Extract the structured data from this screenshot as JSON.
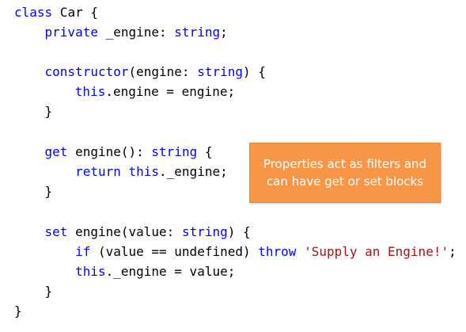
{
  "code": {
    "lines": [
      {
        "key": "l1",
        "tokens": [
          {
            "t": "class",
            "k": "kw"
          },
          {
            "t": " Car {",
            "k": "pl"
          }
        ]
      },
      {
        "key": "l2",
        "tokens": [
          {
            "t": "    ",
            "k": "pl"
          },
          {
            "t": "private",
            "k": "kw"
          },
          {
            "t": " _engine: ",
            "k": "pl"
          },
          {
            "t": "string",
            "k": "kw"
          },
          {
            "t": ";",
            "k": "pl"
          }
        ]
      },
      {
        "key": "l3",
        "tokens": [
          {
            "t": "    ",
            "k": "pl"
          },
          {
            "t": "constructor",
            "k": "kw"
          },
          {
            "t": "(engine: ",
            "k": "pl"
          },
          {
            "t": "string",
            "k": "kw"
          },
          {
            "t": ") {",
            "k": "pl"
          }
        ]
      },
      {
        "key": "l4",
        "tokens": [
          {
            "t": "      ",
            "k": "pl"
          },
          {
            "t": "this",
            "k": "kw"
          },
          {
            "t": ".engine = engine;",
            "k": "pl"
          }
        ]
      },
      {
        "key": "l5",
        "tokens": [
          {
            "t": "    }",
            "k": "pl"
          }
        ]
      },
      {
        "key": "l6",
        "tokens": [
          {
            "t": "    ",
            "k": "pl"
          },
          {
            "t": "get",
            "k": "kw"
          },
          {
            "t": " engine(): ",
            "k": "pl"
          },
          {
            "t": "string",
            "k": "kw"
          },
          {
            "t": " {",
            "k": "pl"
          }
        ]
      },
      {
        "key": "l7",
        "tokens": [
          {
            "t": "        ",
            "k": "pl"
          },
          {
            "t": "return",
            "k": "kw"
          },
          {
            "t": " ",
            "k": "pl"
          },
          {
            "t": "this",
            "k": "kw"
          },
          {
            "t": "._engine;",
            "k": "pl"
          }
        ]
      },
      {
        "key": "l8",
        "tokens": [
          {
            "t": "    }",
            "k": "pl"
          }
        ]
      },
      {
        "key": "l9",
        "tokens": [
          {
            "t": "    ",
            "k": "pl"
          },
          {
            "t": "set",
            "k": "kw"
          },
          {
            "t": " engine(value: ",
            "k": "pl"
          },
          {
            "t": "string",
            "k": "kw"
          },
          {
            "t": ") {",
            "k": "pl"
          }
        ]
      },
      {
        "key": "l10",
        "tokens": [
          {
            "t": "        ",
            "k": "pl"
          },
          {
            "t": "if",
            "k": "kw"
          },
          {
            "t": " (value == undefined) ",
            "k": "pl"
          },
          {
            "t": "throw",
            "k": "kw"
          },
          {
            "t": " ",
            "k": "pl"
          },
          {
            "t": "'Supply an Engine!'",
            "k": "str"
          },
          {
            "t": ";",
            "k": "pl"
          }
        ]
      },
      {
        "key": "l11",
        "tokens": [
          {
            "t": "        ",
            "k": "pl"
          },
          {
            "t": "this",
            "k": "kw"
          },
          {
            "t": "._engine = value;",
            "k": "pl"
          }
        ]
      },
      {
        "key": "l12",
        "tokens": [
          {
            "t": "    }",
            "k": "pl"
          }
        ]
      },
      {
        "key": "l13",
        "tokens": [
          {
            "t": "}",
            "k": "pl"
          }
        ]
      }
    ]
  },
  "callout": {
    "line1": "Properties act as filters and",
    "line2": "can have get or set blocks"
  },
  "colors": {
    "keyword": "#0000ff",
    "string": "#a31515",
    "text": "#000000",
    "callout_bg": "#f79646",
    "callout_text": "#ffffff"
  }
}
